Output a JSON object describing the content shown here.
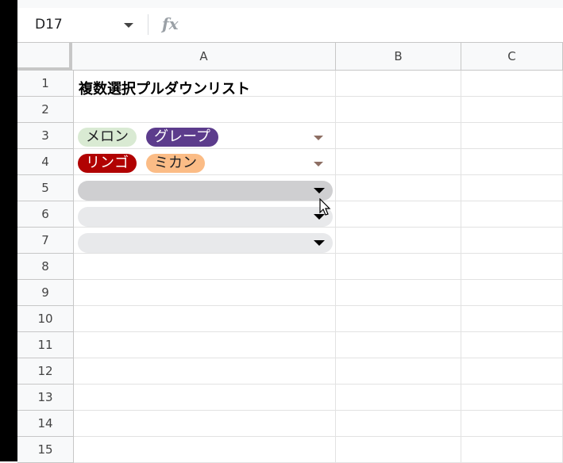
{
  "formula_bar": {
    "cell_ref": "D17",
    "fx_icon": "function-icon"
  },
  "columns": [
    "A",
    "B",
    "C"
  ],
  "rows": [
    "1",
    "2",
    "3",
    "4",
    "5",
    "6",
    "7",
    "8",
    "9",
    "10",
    "11",
    "12",
    "13",
    "14",
    "15"
  ],
  "cells": {
    "A1": "複数選択プルダウンリスト"
  },
  "chips": {
    "row3": [
      {
        "label": "メロン",
        "bg": "#d9ead3",
        "fg": "#202124"
      },
      {
        "label": "グレープ",
        "bg": "#5c3c8c",
        "fg": "#ffffff"
      }
    ],
    "row4": [
      {
        "label": "リンゴ",
        "bg": "#b10202",
        "fg": "#ffffff"
      },
      {
        "label": "ミカン",
        "bg": "#fbbc86",
        "fg": "#202124"
      }
    ]
  },
  "colors": {
    "dropdown_active": "#cfcfd1",
    "dropdown_empty": "#e8e9eb",
    "chip_arrow": "#8d6e63"
  }
}
